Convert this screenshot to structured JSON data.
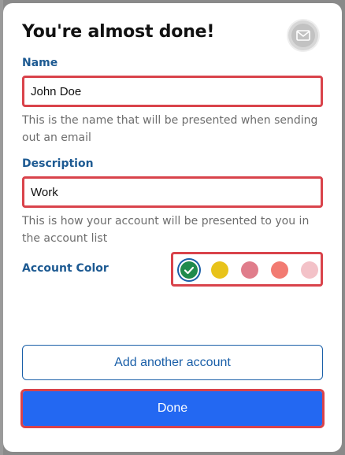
{
  "dialog": {
    "title": "You're almost done!",
    "badge_icon": "mail-icon"
  },
  "name": {
    "label": "Name",
    "value": "John Doe",
    "help": "This is the name that will be presented when sending out an email"
  },
  "description": {
    "label": "Description",
    "value": "Work",
    "help": "This is how your account will be presented to you in the account list"
  },
  "account_color": {
    "label": "Account Color",
    "selected_index": 0,
    "options": [
      {
        "color": "#1f8a4c",
        "name": "green"
      },
      {
        "color": "#e8c31a",
        "name": "yellow"
      },
      {
        "color": "#e07d8b",
        "name": "rose"
      },
      {
        "color": "#f27b72",
        "name": "salmon"
      },
      {
        "color": "#f3c2c8",
        "name": "light-pink"
      }
    ]
  },
  "buttons": {
    "add_account_label": "Add another account",
    "done_label": "Done"
  },
  "colors": {
    "highlight_border": "#d9434b",
    "primary": "#2368f2",
    "link": "#1a5fa8",
    "label": "#1d5a92"
  }
}
